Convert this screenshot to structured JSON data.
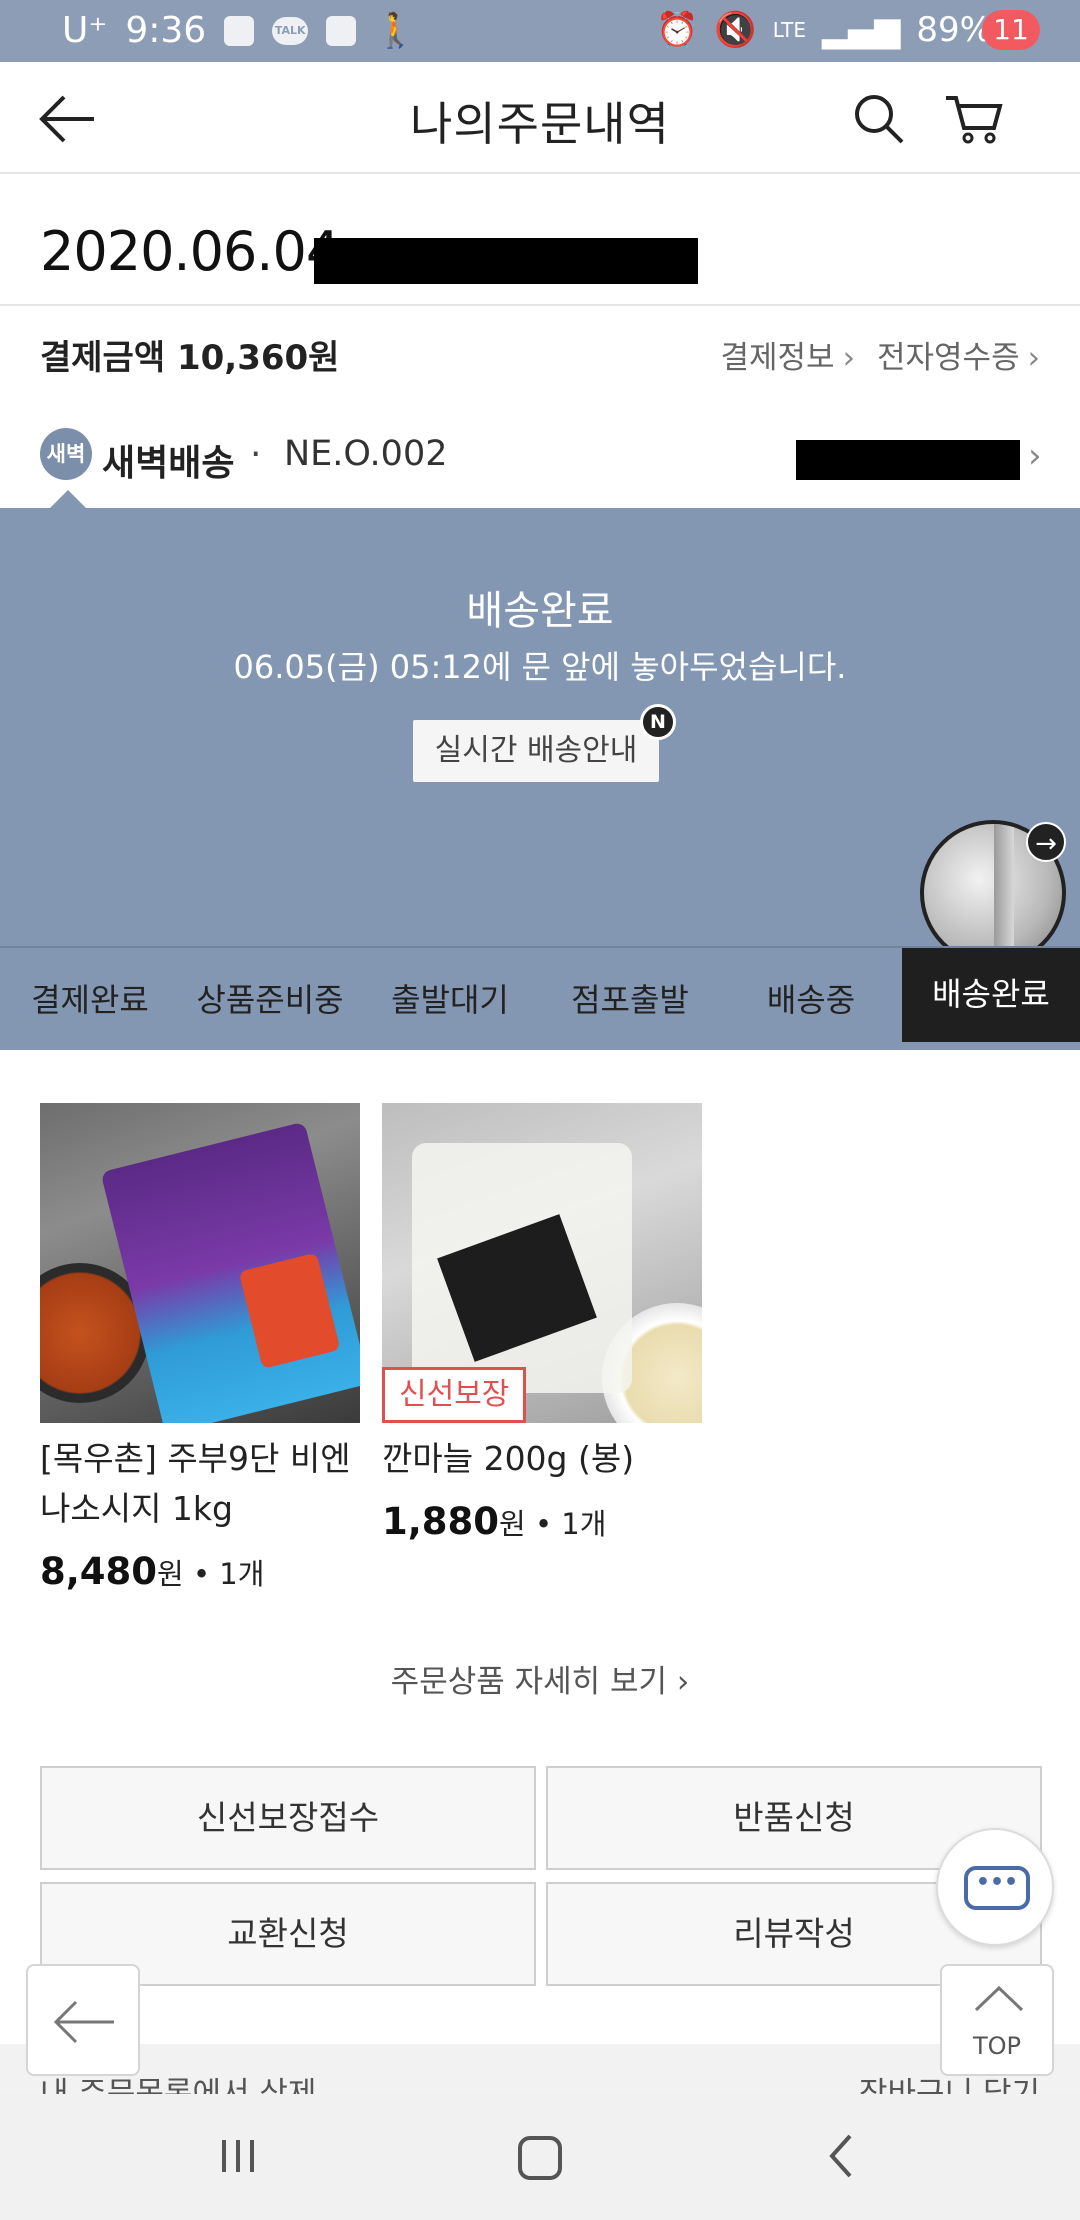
{
  "status_bar": {
    "carrier": "U⁺",
    "time": "9:36",
    "talk_label": "TALK",
    "network": "LTE",
    "battery": "89%"
  },
  "header": {
    "title": "나의주문내역",
    "cart_count": "11"
  },
  "order": {
    "date": "2020.06.04",
    "pay_label": "결제금액",
    "pay_amount": "10,360원",
    "pay_info_link": "결제정보",
    "receipt_link": "전자영수증"
  },
  "delivery": {
    "badge": "새벽",
    "type": "새벽배송",
    "dot": "·",
    "code": "NE.O.002",
    "status_title": "배송완료",
    "status_message": "06.05(금) 05:12에 문 앞에 놓아두었습니다.",
    "live_button": "실시간 배송안내",
    "new_badge": "N"
  },
  "steps": [
    {
      "label": "결제완료",
      "active": false
    },
    {
      "label": "상품준비중",
      "active": false
    },
    {
      "label": "출발대기",
      "active": false
    },
    {
      "label": "점포출발",
      "active": false
    },
    {
      "label": "배송중",
      "active": false
    },
    {
      "label": "배송완료",
      "active": true
    }
  ],
  "products": [
    {
      "name": "[목우촌] 주부9단 비엔나소시지 1kg",
      "price": "8,480",
      "won": "원",
      "qty": "1개",
      "tag": ""
    },
    {
      "name": "깐마늘 200g (봉)",
      "price": "1,880",
      "won": "원",
      "qty": "1개",
      "tag": "신선보장"
    }
  ],
  "detail_link": "주문상품 자세히 보기",
  "actions": {
    "fresh_claim": "신선보장접수",
    "return": "반품신청",
    "exchange": "교환신청",
    "review": "리뷰작성"
  },
  "floating": {
    "top_label": "TOP",
    "chat_dots": "•••"
  },
  "footer": {
    "delete": "내 주문목록에서 삭제",
    "add_cart": "장바구니 담기"
  },
  "colors": {
    "panel": "#8497b2",
    "active_step": "#1f1f1f",
    "cart_badge": "#f25a5f",
    "fresh_tag": "#e05050"
  }
}
